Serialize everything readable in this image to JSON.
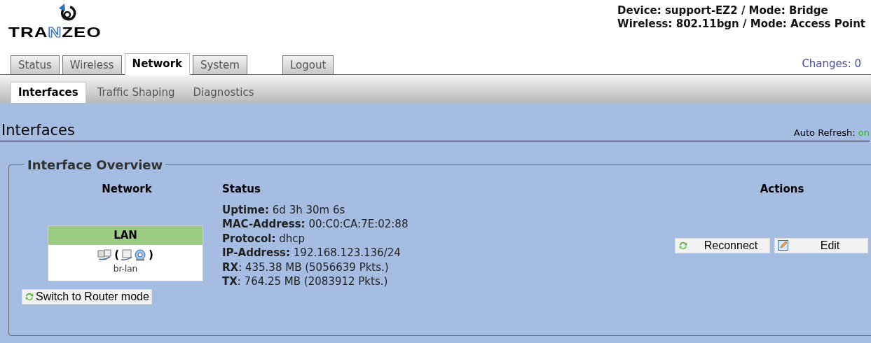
{
  "logo": {
    "parts": [
      {
        "text": "TRA",
        "highlight": false
      },
      {
        "text": "N",
        "highlight": true
      },
      {
        "text": "ZEO",
        "highlight": false
      }
    ]
  },
  "device_info": [
    "Device: support-EZ2 / Mode: Bridge",
    "Wireless: 802.11bgn / Mode: Access Point"
  ],
  "tabs": [
    {
      "label": "Status",
      "selected": false
    },
    {
      "label": "Wireless",
      "selected": false
    },
    {
      "label": "Network",
      "selected": true
    },
    {
      "label": "System",
      "selected": false
    },
    {
      "label": "Logout",
      "selected": false,
      "kind": "logout"
    }
  ],
  "changes": "Changes: 0",
  "subtabs": [
    {
      "label": "Interfaces",
      "selected": true
    },
    {
      "label": "Traffic Shaping",
      "selected": false
    },
    {
      "label": "Diagnostics",
      "selected": false
    }
  ],
  "page_title": "Interfaces",
  "auto_refresh": {
    "label": "Auto Refresh:",
    "value": "on",
    "on": true
  },
  "overview": {
    "legend": "Interface Overview",
    "columns": [
      "Network",
      "Status",
      "Actions"
    ],
    "interface": {
      "name": "LAN",
      "color": "#9ccc83",
      "device": "br-lan",
      "brackets": [
        "(",
        ")"
      ],
      "status": [
        "**Uptime:** 6d 3h 30m 6s",
        "**MAC-Address:** 00:C0:CA:7E:02:88",
        "**Protocol:** dhcp",
        "**IP-Address:** 192.168.123.136/24",
        "**RX**: 435.38 MB (5056639 Pkts.)",
        "**TX**: 764.25 MB (2083912 Pkts.)"
      ]
    },
    "actions": [
      {
        "label": "Reconnect",
        "kind": "reconnect"
      },
      {
        "label": "Edit",
        "kind": "edit"
      }
    ],
    "switch_button": "Switch to Router mode"
  }
}
